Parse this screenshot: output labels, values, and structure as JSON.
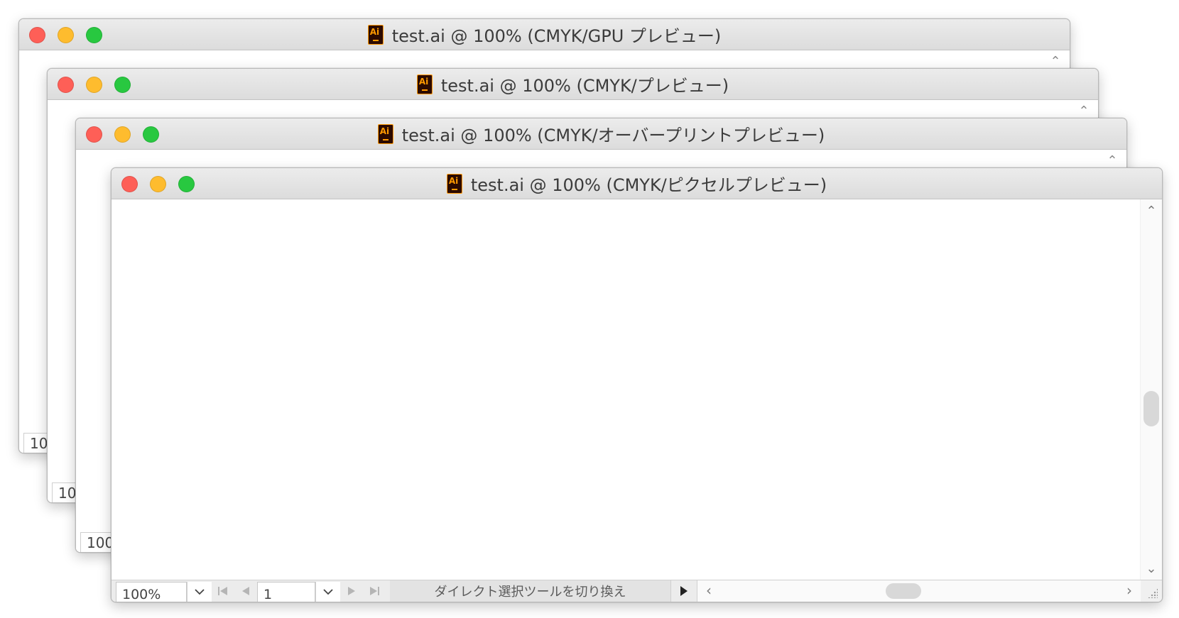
{
  "windows": [
    {
      "title": "test.ai @ 100% (CMYK/GPU プレビュー)",
      "zoom": "10"
    },
    {
      "title": "test.ai @ 100% (CMYK/プレビュー)",
      "zoom": "10"
    },
    {
      "title": "test.ai @ 100% (CMYK/オーバープリントプレビュー)",
      "zoom": "100"
    },
    {
      "title": "test.ai @ 100% (CMYK/ピクセルプレビュー)"
    }
  ],
  "statusbar": {
    "zoom": "100%",
    "page": "1",
    "status_text": "ダイレクト選択ツールを切り換え"
  },
  "icons": {
    "app": "illustrator-icon",
    "chevron_down": "⌄",
    "scroll_up": "⌃",
    "scroll_down": "⌄",
    "scroll_left": "‹",
    "scroll_right": "›"
  }
}
